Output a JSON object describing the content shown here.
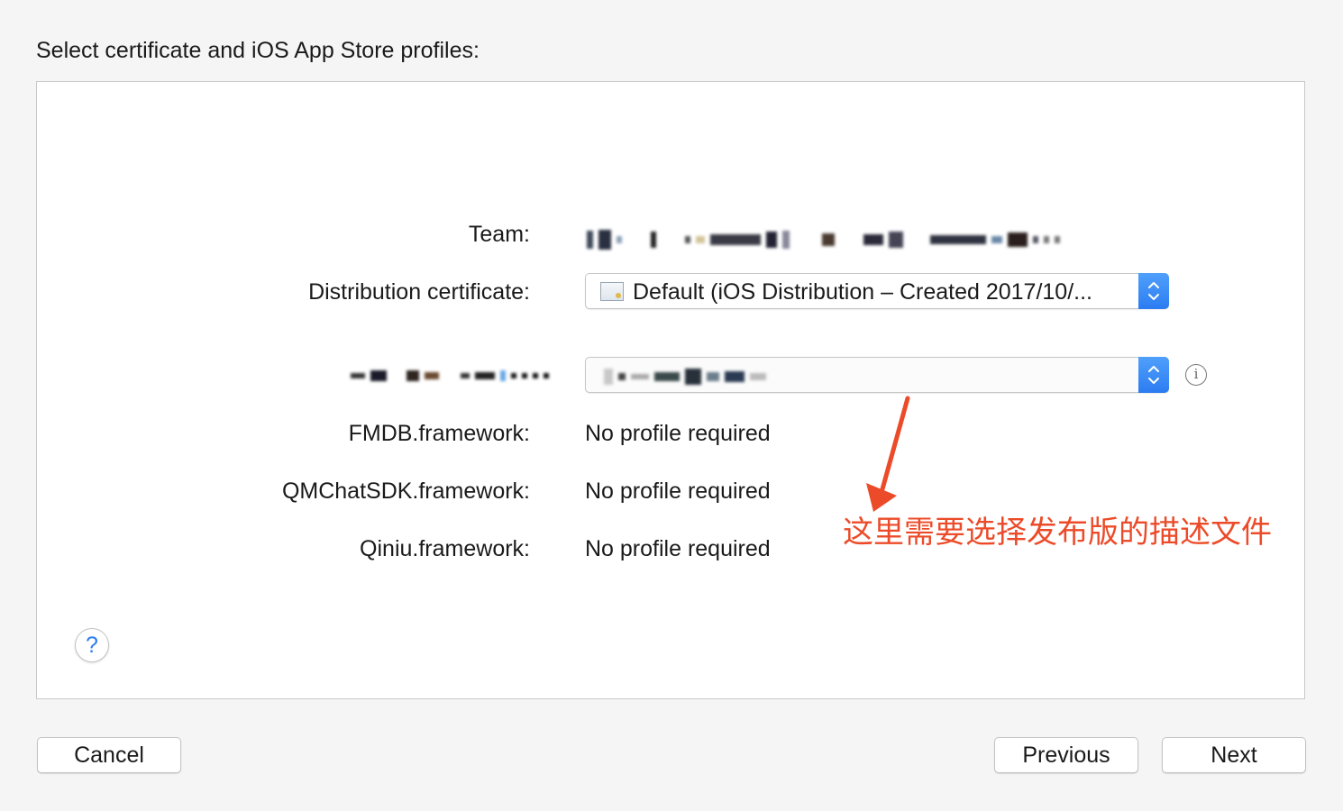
{
  "header": {
    "title": "Select certificate and iOS App Store profiles:"
  },
  "form": {
    "team_label": "Team:",
    "distribution_label": "Distribution certificate:",
    "distribution_value": "Default (iOS Distribution – Created 2017/10/...",
    "fmdb_label": "FMDB.framework:",
    "fmdb_value": "No profile required",
    "qmchat_label": "QMChatSDK.framework:",
    "qmchat_value": "No profile required",
    "qiniu_label": "Qiniu.framework:",
    "qiniu_value": "No profile required"
  },
  "help": {
    "label": "?"
  },
  "info_icon": "i",
  "annotation": {
    "text": "这里需要选择发布版的描述文件",
    "color": "#ec4b29"
  },
  "footer": {
    "cancel_label": "Cancel",
    "previous_label": "Previous",
    "next_label": "Next"
  },
  "colors": {
    "accent": "#2d7cf0",
    "background": "#f5f5f5",
    "panel": "#ffffff"
  }
}
